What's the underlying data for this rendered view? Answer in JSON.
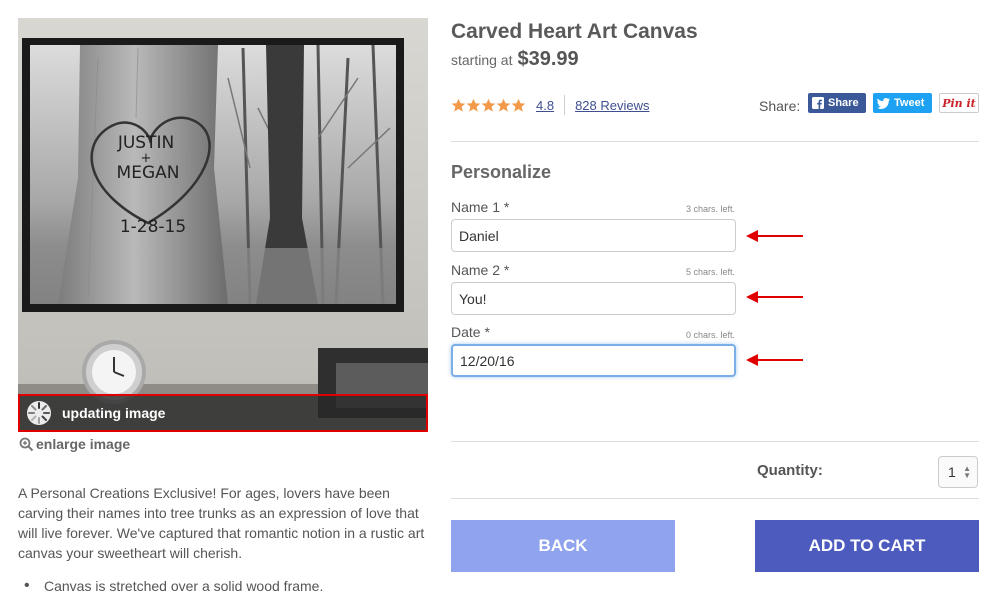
{
  "product": {
    "title": "Carved Heart Art Canvas",
    "starting_label": "starting at",
    "price": "$39.99",
    "rating": "4.8",
    "rating_stars": 4.8,
    "reviews": "828 Reviews"
  },
  "image": {
    "carving_name1": "JUSTIN",
    "carving_plus": "+",
    "carving_name2": "MEGAN",
    "carving_date": "1-28-15",
    "updating_text": "updating image",
    "enlarge_text": "enlarge image"
  },
  "share": {
    "label": "Share:",
    "facebook": "Share",
    "twitter": "Tweet",
    "pinterest": "Pin it"
  },
  "personalize": {
    "title": "Personalize",
    "fields": [
      {
        "label": "Name 1 *",
        "value": "Daniel",
        "chars_left": "3 chars. left."
      },
      {
        "label": "Name 2 *",
        "value": "You!",
        "chars_left": "5 chars. left."
      },
      {
        "label": "Date *",
        "value": "12/20/16",
        "chars_left": "0 chars. left."
      }
    ]
  },
  "quantity": {
    "label": "Quantity:",
    "value": "1"
  },
  "buttons": {
    "back": "BACK",
    "add_to_cart": "ADD TO CART"
  },
  "description": {
    "text": "A Personal Creations Exclusive! For ages, lovers have been carving their names into tree trunks as an expression of love that will live forever. We've captured that romantic notion in a rustic art canvas your sweetheart will cherish.",
    "bullets": [
      "Canvas is stretched over a solid wood frame."
    ]
  },
  "colors": {
    "link": "#3f4f8f",
    "star": "#f2994a",
    "back_button": "#8fa3ee",
    "cart_button": "#4d5bbf",
    "highlight_border": "#e00000",
    "arrow": "#e00000",
    "facebook": "#3b5998",
    "twitter": "#1da1f2",
    "pinterest": "#c92228"
  },
  "icons": {
    "spinner": "loading-spinner-icon",
    "enlarge": "magnifier-plus-icon",
    "facebook": "facebook-icon",
    "twitter": "twitter-bird-icon",
    "star": "star-icon",
    "arrow": "left-arrow-icon"
  }
}
